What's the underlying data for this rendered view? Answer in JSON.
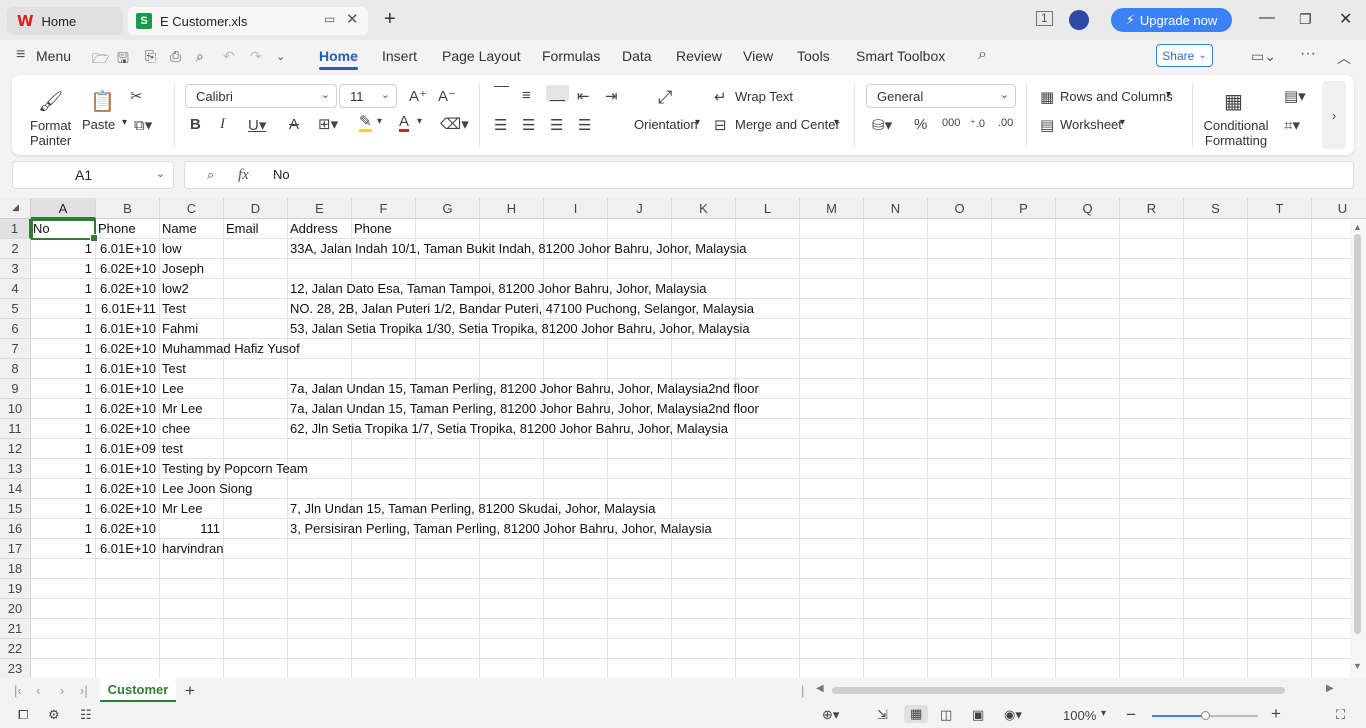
{
  "titlebar": {
    "tabs": [
      {
        "label": "Home"
      },
      {
        "label": "E Customer.xls"
      }
    ],
    "upgrade_label": "Upgrade now"
  },
  "menubar": {
    "menu_label": "Menu",
    "items": [
      "Home",
      "Insert",
      "Page Layout",
      "Formulas",
      "Data",
      "Review",
      "View",
      "Tools",
      "Smart Toolbox"
    ],
    "active": "Home",
    "share_label": "Share"
  },
  "ribbon": {
    "format_painter": "Format Painter",
    "paste": "Paste",
    "font_name": "Calibri",
    "font_size": "11",
    "wrap_text": "Wrap Text",
    "orientation": "Orientation",
    "merge_center": "Merge and Center",
    "number_format": "General",
    "rows_columns": "Rows and Columns",
    "worksheet": "Worksheet",
    "conditional_formatting": "Conditional Formatting",
    "accent": "#1f5fbf",
    "font_color": "#d8211d",
    "highlight_color": "#f5d800"
  },
  "formula_bar": {
    "name_box": "A1",
    "fx": "fx",
    "content": "No"
  },
  "sheet": {
    "columns": [
      "A",
      "B",
      "C",
      "D",
      "E",
      "F",
      "G",
      "H",
      "I",
      "J",
      "K",
      "L",
      "M",
      "N",
      "O",
      "P",
      "Q",
      "R",
      "S",
      "T",
      "U"
    ],
    "row_numbers": [
      "1",
      "2",
      "3",
      "4",
      "5",
      "6",
      "7",
      "8",
      "9",
      "10",
      "11",
      "12",
      "13",
      "14",
      "15",
      "16",
      "17",
      "18",
      "19",
      "20",
      "21",
      "22",
      "23"
    ],
    "header_row": [
      "No",
      "Phone",
      "Name",
      "Email",
      "Address",
      "Phone"
    ],
    "rows": [
      {
        "no": "1",
        "phone": "6.01E+10",
        "name": "low",
        "email": "",
        "address": "33A, Jalan Indah 10/1, Taman Bukit Indah, 81200 Johor Bahru, Johor, Malaysia"
      },
      {
        "no": "1",
        "phone": "6.02E+10",
        "name": "Joseph",
        "email": "",
        "address": ""
      },
      {
        "no": "1",
        "phone": "6.02E+10",
        "name": "low2",
        "email": "",
        "address": "12, Jalan Dato Esa, Taman Tampoi, 81200 Johor Bahru, Johor, Malaysia"
      },
      {
        "no": "1",
        "phone": "6.01E+11",
        "name": "Test",
        "email": "",
        "address": "NO. 28, 2B, Jalan Puteri 1/2, Bandar Puteri, 47100 Puchong, Selangor, Malaysia"
      },
      {
        "no": "1",
        "phone": "6.01E+10",
        "name": "Fahmi",
        "email": "",
        "address": "53, Jalan Setia Tropika 1/30, Setia Tropika, 81200 Johor Bahru, Johor, Malaysia"
      },
      {
        "no": "1",
        "phone": "6.02E+10",
        "name": "Muhammad Hafiz Yusof",
        "email": "",
        "address": ""
      },
      {
        "no": "1",
        "phone": "6.01E+10",
        "name": "Test",
        "email": "",
        "address": ""
      },
      {
        "no": "1",
        "phone": "6.01E+10",
        "name": "Lee",
        "email": "",
        "address": "7a, Jalan Undan 15, Taman Perling, 81200 Johor Bahru, Johor, Malaysia2nd floor"
      },
      {
        "no": "1",
        "phone": "6.02E+10",
        "name": "Mr Lee",
        "email": "",
        "address": "7a, Jalan Undan 15, Taman Perling, 81200 Johor Bahru, Johor, Malaysia2nd floor"
      },
      {
        "no": "1",
        "phone": "6.02E+10",
        "name": "chee",
        "email": "",
        "address": "62, Jln Setia Tropika 1/7, Setia Tropika, 81200 Johor Bahru, Johor, Malaysia"
      },
      {
        "no": "1",
        "phone": "6.01E+09",
        "name": "test",
        "email": "",
        "address": ""
      },
      {
        "no": "1",
        "phone": "6.01E+10",
        "name": "Testing by Popcorn Team",
        "email": "",
        "address": ""
      },
      {
        "no": "1",
        "phone": "6.02E+10",
        "name": "Lee Joon Siong",
        "email": "",
        "address": ""
      },
      {
        "no": "1",
        "phone": "6.02E+10",
        "name": "Mr Lee",
        "email": "",
        "address": "7, Jln Undan 15, Taman Perling, 81200 Skudai, Johor, Malaysia"
      },
      {
        "no": "1",
        "phone": "6.02E+10",
        "name": "111",
        "email": "",
        "address": "3, Persisiran Perling, Taman Perling, 81200 Johor Bahru, Johor, Malaysia"
      },
      {
        "no": "1",
        "phone": "6.01E+10",
        "name": "harvindran",
        "email": "",
        "address": ""
      }
    ],
    "active_cell": "A1",
    "grid_accent": "#2f7d32"
  },
  "sheet_tabs": {
    "active": "Customer"
  },
  "statusbar": {
    "zoom": "100%"
  }
}
